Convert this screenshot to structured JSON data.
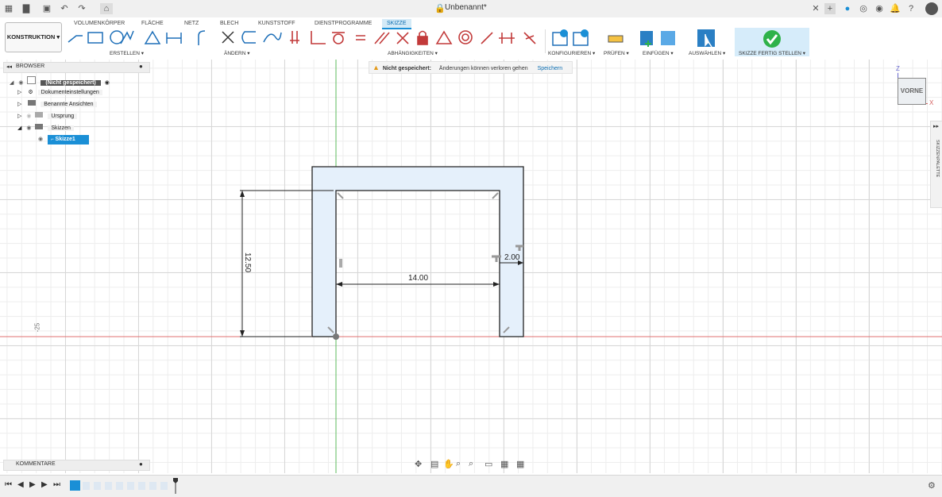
{
  "app": {
    "doc_title": "Unbenannt*",
    "workspace": "KONSTRUKTION"
  },
  "tabs": [
    "VOLUMENKÖRPER",
    "FLÄCHE",
    "NETZ",
    "BLECH",
    "KUNSTSTOFF",
    "DIENSTPROGRAMME",
    "SKIZZE"
  ],
  "active_tab": "SKIZZE",
  "groups": {
    "erstellen": "ERSTELLEN ▾",
    "aendern": "ÄNDERN ▾",
    "abhaengigkeiten": "ABHÄNGIGKEITEN ▾",
    "konfigurieren": "KONFIGURIEREN ▾",
    "pruefen": "PRÜFEN ▾",
    "einfuegen": "EINFÜGEN ▾",
    "auswaehlen": "AUSWÄHLEN ▾",
    "skizze_fertig": "SKIZZE FERTIG STELLEN ▾"
  },
  "browser": {
    "title": "BROWSER",
    "root": "(Nicht gespeichert)",
    "items": [
      "Dokumenteinstellungen",
      "Benannte Ansichten",
      "Ursprung",
      "Skizzen"
    ],
    "sketch": "Skizze1"
  },
  "warning": {
    "label": "Nicht gespeichert:",
    "message": "Änderungen können verloren gehen",
    "action": "Speichern"
  },
  "sketch": {
    "dim_height": "12.50",
    "dim_width": "14.00",
    "dim_thickness": "2.00",
    "axis_tick": "-25"
  },
  "viewcube": {
    "face": "VORNE",
    "axis_z": "Z",
    "axis_x": "X"
  },
  "palette_label": "SKIZZENPALETTE",
  "comments": "KOMMENTARE",
  "colors": {
    "accent": "#1a8fd6",
    "sketch_fill": "#e5f0fb",
    "origin_x": "#e07070",
    "origin_y": "#5dbb5d",
    "finish_green": "#2fb24a"
  }
}
